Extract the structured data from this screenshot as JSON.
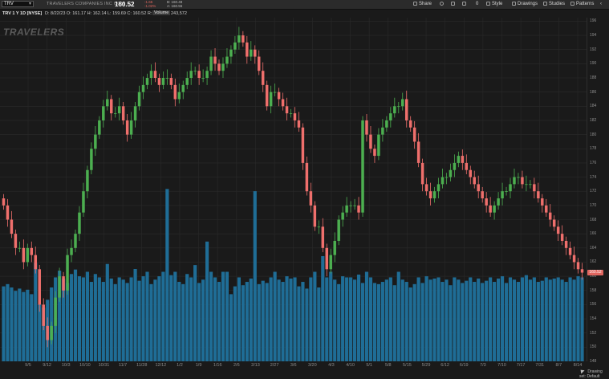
{
  "header": {
    "symbol": "TRV",
    "company": "TRAVELERS COMPANIES INC COM",
    "last_price": "160.52",
    "change": "-1.65",
    "change_pct": "-1.02%",
    "bid": "B: 160.48",
    "ask": "A: 160.55",
    "toolbar": {
      "share": "Share",
      "style": "Style",
      "drawings": "Drawings",
      "studies": "Studies",
      "patterns": "Patterns",
      "counter": "0"
    }
  },
  "info": {
    "label": "TRV 1 Y 1D [NYSE]",
    "ohlc": "D: 8/22/23   O: 161.17   H: 162.14   L: 159.69   C: 160.52   R: 2.45",
    "volume_label": "Volume",
    "volume_value": "243,572"
  },
  "watermark": "TRAVELERS",
  "status": {
    "drawing_set": "Drawing set: Default"
  },
  "colors": {
    "up": "#4caf50",
    "down": "#ef6f6c",
    "volume": "#1f6d96",
    "grid": "#2a2a2a"
  },
  "chart_data": {
    "type": "candlestick",
    "x_tick_labels": [
      "9/5",
      "9/12",
      "10/3",
      "10/10",
      "10/31",
      "11/7",
      "11/28",
      "12/12",
      "1/2",
      "1/9",
      "1/16",
      "2/6",
      "2/13",
      "2/27",
      "3/6",
      "3/20",
      "4/3",
      "4/10",
      "5/1",
      "5/8",
      "5/15",
      "5/29",
      "6/12",
      "6/19",
      "7/3",
      "7/10",
      "7/17",
      "7/31",
      "8/7",
      "8/14"
    ],
    "y_ticks": [
      148,
      150,
      152,
      154,
      156,
      158,
      160,
      162,
      164,
      166,
      168,
      170,
      172,
      174,
      176,
      178,
      180,
      182,
      184,
      186,
      188,
      190,
      192,
      194,
      196
    ],
    "ylim": [
      148,
      196.5
    ],
    "last_price": 160.52,
    "close": [
      170,
      168,
      166,
      164,
      164,
      162,
      164,
      163,
      161,
      156,
      153,
      151,
      153,
      157,
      160,
      158,
      163,
      164,
      166,
      169,
      172,
      175,
      178,
      180,
      182,
      184,
      185,
      183,
      183,
      184,
      182,
      180,
      182,
      184,
      186,
      187,
      188,
      189,
      188,
      187,
      188,
      188,
      187,
      185,
      186,
      187,
      188,
      189,
      189,
      188,
      188,
      189,
      191,
      190,
      189,
      190,
      191,
      192,
      193,
      194,
      193,
      191,
      192,
      191,
      189,
      187,
      184,
      186,
      186,
      185,
      184,
      183,
      183,
      182,
      181,
      176,
      172,
      170,
      167,
      167,
      164,
      161,
      163,
      165,
      168,
      169,
      170,
      170,
      170,
      169,
      182,
      180,
      178,
      177,
      180,
      181,
      182,
      183,
      184,
      184,
      185,
      182,
      181,
      179,
      176,
      173,
      172,
      171,
      172,
      173,
      174,
      174,
      175,
      176,
      177,
      176,
      175,
      174,
      173,
      172,
      171,
      170,
      169,
      170,
      171,
      172,
      172,
      173,
      174,
      174,
      173,
      173,
      173,
      172,
      171,
      170,
      169,
      168,
      167,
      166,
      165,
      164,
      163,
      162,
      161,
      160.52
    ],
    "volume": [
      134000,
      138000,
      132000,
      126000,
      130000,
      124000,
      128000,
      120000,
      176000,
      102000,
      96000,
      110000,
      132000,
      150000,
      162000,
      148000,
      140000,
      156000,
      164000,
      152000,
      150000,
      160000,
      142000,
      156000,
      150000,
      142000,
      174000,
      148000,
      138000,
      150000,
      146000,
      140000,
      150000,
      165000,
      144000,
      152000,
      160000,
      138000,
      146000,
      152000,
      160000,
      308000,
      154000,
      160000,
      142000,
      138000,
      156000,
      150000,
      172000,
      140000,
      146000,
      214000,
      160000,
      150000,
      142000,
      160000,
      160000,
      120000,
      134000,
      150000,
      136000,
      142000,
      148000,
      304000,
      138000,
      144000,
      140000,
      150000,
      160000,
      146000,
      142000,
      152000,
      148000,
      150000,
      134000,
      142000,
      130000,
      150000,
      160000,
      132000,
      188000,
      150000,
      160000,
      146000,
      138000,
      152000,
      150000,
      150000,
      146000,
      155000,
      140000,
      160000,
      150000,
      140000,
      138000,
      142000,
      146000,
      150000,
      136000,
      160000,
      146000,
      142000,
      132000,
      138000,
      150000,
      140000,
      152000,
      146000,
      148000,
      150000,
      142000,
      146000,
      136000,
      150000,
      146000,
      140000,
      144000,
      150000,
      142000,
      148000,
      140000,
      144000,
      150000,
      142000,
      148000,
      152000,
      140000,
      150000,
      146000,
      142000,
      150000,
      154000,
      146000,
      150000,
      142000,
      144000,
      150000,
      146000,
      148000,
      150000,
      146000,
      142000,
      150000,
      146000,
      152000,
      150000
    ],
    "volume_range": [
      0,
      330000
    ]
  }
}
